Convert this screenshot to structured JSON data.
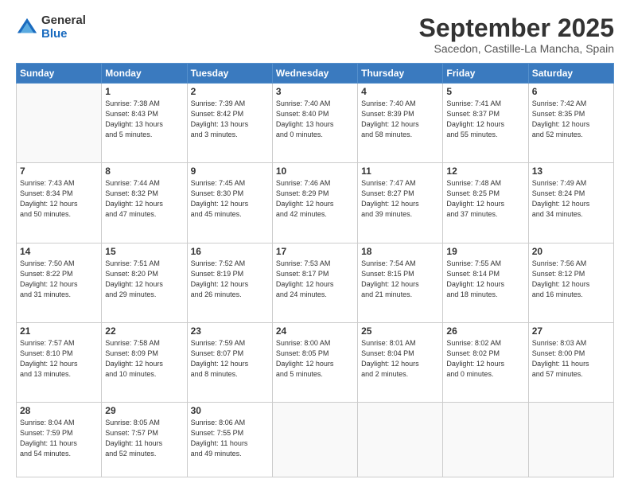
{
  "logo": {
    "general": "General",
    "blue": "Blue"
  },
  "header": {
    "title": "September 2025",
    "subtitle": "Sacedon, Castille-La Mancha, Spain"
  },
  "days_header": [
    "Sunday",
    "Monday",
    "Tuesday",
    "Wednesday",
    "Thursday",
    "Friday",
    "Saturday"
  ],
  "weeks": [
    [
      {
        "day": "",
        "info": ""
      },
      {
        "day": "1",
        "info": "Sunrise: 7:38 AM\nSunset: 8:43 PM\nDaylight: 13 hours\nand 5 minutes."
      },
      {
        "day": "2",
        "info": "Sunrise: 7:39 AM\nSunset: 8:42 PM\nDaylight: 13 hours\nand 3 minutes."
      },
      {
        "day": "3",
        "info": "Sunrise: 7:40 AM\nSunset: 8:40 PM\nDaylight: 13 hours\nand 0 minutes."
      },
      {
        "day": "4",
        "info": "Sunrise: 7:40 AM\nSunset: 8:39 PM\nDaylight: 12 hours\nand 58 minutes."
      },
      {
        "day": "5",
        "info": "Sunrise: 7:41 AM\nSunset: 8:37 PM\nDaylight: 12 hours\nand 55 minutes."
      },
      {
        "day": "6",
        "info": "Sunrise: 7:42 AM\nSunset: 8:35 PM\nDaylight: 12 hours\nand 52 minutes."
      }
    ],
    [
      {
        "day": "7",
        "info": "Sunrise: 7:43 AM\nSunset: 8:34 PM\nDaylight: 12 hours\nand 50 minutes."
      },
      {
        "day": "8",
        "info": "Sunrise: 7:44 AM\nSunset: 8:32 PM\nDaylight: 12 hours\nand 47 minutes."
      },
      {
        "day": "9",
        "info": "Sunrise: 7:45 AM\nSunset: 8:30 PM\nDaylight: 12 hours\nand 45 minutes."
      },
      {
        "day": "10",
        "info": "Sunrise: 7:46 AM\nSunset: 8:29 PM\nDaylight: 12 hours\nand 42 minutes."
      },
      {
        "day": "11",
        "info": "Sunrise: 7:47 AM\nSunset: 8:27 PM\nDaylight: 12 hours\nand 39 minutes."
      },
      {
        "day": "12",
        "info": "Sunrise: 7:48 AM\nSunset: 8:25 PM\nDaylight: 12 hours\nand 37 minutes."
      },
      {
        "day": "13",
        "info": "Sunrise: 7:49 AM\nSunset: 8:24 PM\nDaylight: 12 hours\nand 34 minutes."
      }
    ],
    [
      {
        "day": "14",
        "info": "Sunrise: 7:50 AM\nSunset: 8:22 PM\nDaylight: 12 hours\nand 31 minutes."
      },
      {
        "day": "15",
        "info": "Sunrise: 7:51 AM\nSunset: 8:20 PM\nDaylight: 12 hours\nand 29 minutes."
      },
      {
        "day": "16",
        "info": "Sunrise: 7:52 AM\nSunset: 8:19 PM\nDaylight: 12 hours\nand 26 minutes."
      },
      {
        "day": "17",
        "info": "Sunrise: 7:53 AM\nSunset: 8:17 PM\nDaylight: 12 hours\nand 24 minutes."
      },
      {
        "day": "18",
        "info": "Sunrise: 7:54 AM\nSunset: 8:15 PM\nDaylight: 12 hours\nand 21 minutes."
      },
      {
        "day": "19",
        "info": "Sunrise: 7:55 AM\nSunset: 8:14 PM\nDaylight: 12 hours\nand 18 minutes."
      },
      {
        "day": "20",
        "info": "Sunrise: 7:56 AM\nSunset: 8:12 PM\nDaylight: 12 hours\nand 16 minutes."
      }
    ],
    [
      {
        "day": "21",
        "info": "Sunrise: 7:57 AM\nSunset: 8:10 PM\nDaylight: 12 hours\nand 13 minutes."
      },
      {
        "day": "22",
        "info": "Sunrise: 7:58 AM\nSunset: 8:09 PM\nDaylight: 12 hours\nand 10 minutes."
      },
      {
        "day": "23",
        "info": "Sunrise: 7:59 AM\nSunset: 8:07 PM\nDaylight: 12 hours\nand 8 minutes."
      },
      {
        "day": "24",
        "info": "Sunrise: 8:00 AM\nSunset: 8:05 PM\nDaylight: 12 hours\nand 5 minutes."
      },
      {
        "day": "25",
        "info": "Sunrise: 8:01 AM\nSunset: 8:04 PM\nDaylight: 12 hours\nand 2 minutes."
      },
      {
        "day": "26",
        "info": "Sunrise: 8:02 AM\nSunset: 8:02 PM\nDaylight: 12 hours\nand 0 minutes."
      },
      {
        "day": "27",
        "info": "Sunrise: 8:03 AM\nSunset: 8:00 PM\nDaylight: 11 hours\nand 57 minutes."
      }
    ],
    [
      {
        "day": "28",
        "info": "Sunrise: 8:04 AM\nSunset: 7:59 PM\nDaylight: 11 hours\nand 54 minutes."
      },
      {
        "day": "29",
        "info": "Sunrise: 8:05 AM\nSunset: 7:57 PM\nDaylight: 11 hours\nand 52 minutes."
      },
      {
        "day": "30",
        "info": "Sunrise: 8:06 AM\nSunset: 7:55 PM\nDaylight: 11 hours\nand 49 minutes."
      },
      {
        "day": "",
        "info": ""
      },
      {
        "day": "",
        "info": ""
      },
      {
        "day": "",
        "info": ""
      },
      {
        "day": "",
        "info": ""
      }
    ]
  ]
}
